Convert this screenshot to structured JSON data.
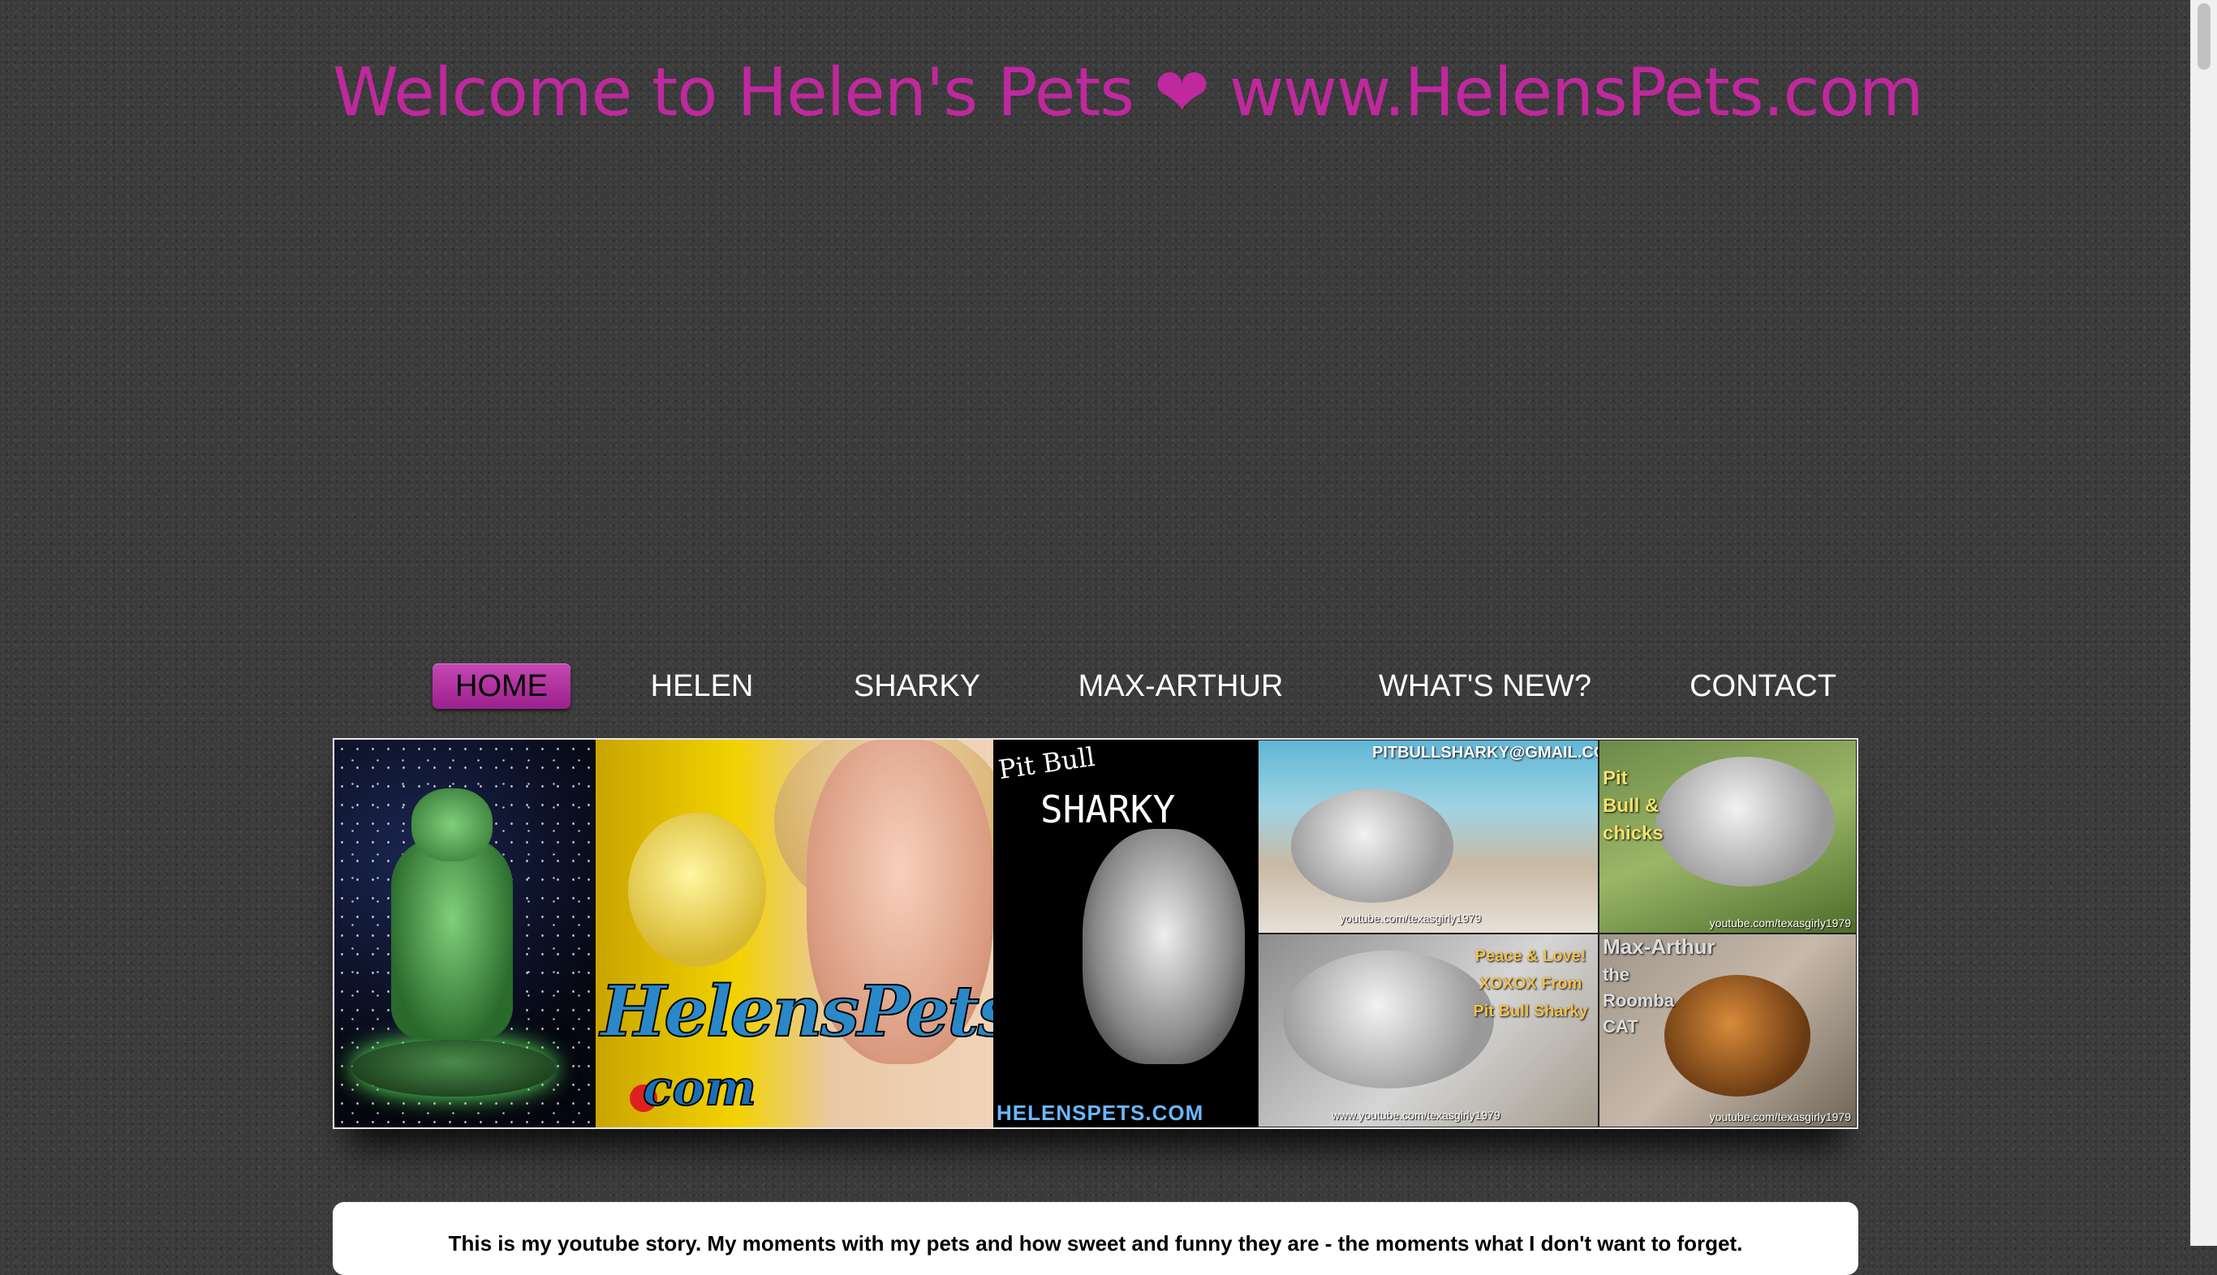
{
  "header": {
    "title": "Welcome to Helen's Pets ❤ www.HelensPets.com",
    "title_color": "#c0289e"
  },
  "nav": {
    "items": [
      {
        "label": "HOME",
        "active": true
      },
      {
        "label": "HELEN"
      },
      {
        "label": "SHARKY"
      },
      {
        "label": "MAX-ARTHUR"
      },
      {
        "label": "WHAT'S NEW?"
      },
      {
        "label": "CONTACT"
      }
    ],
    "active_color": "#b0309e"
  },
  "banner": {
    "logo_text": "HelensPets",
    "logo_suffix": "com",
    "sharky_top": "Pit Bull",
    "sharky_vertical": "SHARKY",
    "sharky_url": "HELENSPETS.COM",
    "email": "PITBULLSHARKY@GMAIL.COM",
    "youtube_1": "youtube.com/texasgirly1979",
    "chicks_title": "Pit Bull & chicks",
    "youtube_2": "youtube.com/texasgirly1979",
    "peace_text": "Peace & Love! XOXOX From Pit Bull Sharky",
    "youtube_3": "www.youtube.com/texasgirly1979",
    "max_title": "Max-Arthur",
    "max_sub": "the Roomba CAT",
    "youtube_4": "youtube.com/texasgirly1979"
  },
  "content": {
    "intro": "This is my youtube story. My moments with my pets and how sweet and funny they are - the moments what I don't want to forget."
  }
}
